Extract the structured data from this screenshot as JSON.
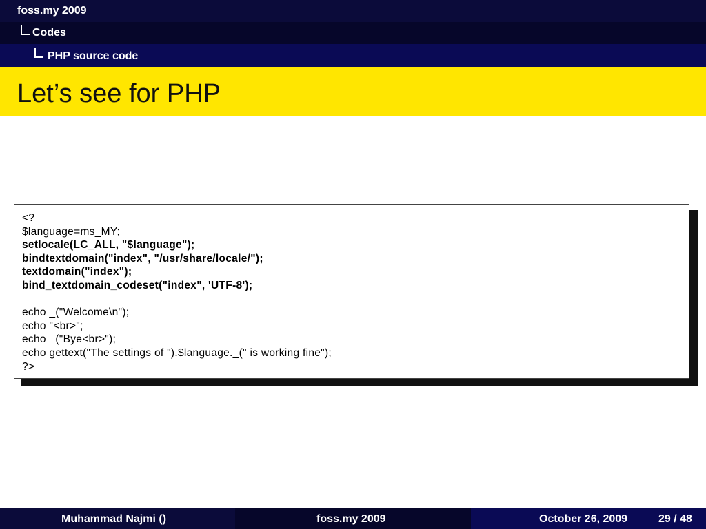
{
  "header": {
    "section": "foss.my 2009",
    "subsection": "Codes",
    "subsubsection": "PHP source code"
  },
  "slide": {
    "title": "Let’s see for PHP"
  },
  "code": {
    "lines": [
      "<?",
      "$language=ms_MY;",
      "setlocale(LC_ALL, \"$language\");",
      "bindtextdomain(\"index\", \"/usr/share/locale/\");",
      "textdomain(\"index\");",
      "bind_textdomain_codeset(\"index\", 'UTF-8');",
      "",
      "echo _(\"Welcome\\n\");",
      "echo \"<br>\";",
      "echo _(\"Bye<br>\");",
      "echo gettext(\"The settings of \").$language._(\" is working fine\");",
      "?>"
    ]
  },
  "footer": {
    "author": "Muhammad Najmi ()",
    "event": "foss.my 2009",
    "date": "October 26, 2009",
    "page": "29 / 48"
  }
}
